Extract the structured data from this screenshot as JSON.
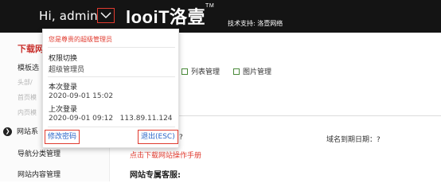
{
  "header": {
    "greeting": "Hi, admin",
    "logo_text": "looiT洛壹",
    "logo_mark": "TM",
    "support": "技术支持: 洛壹网络"
  },
  "sidebar": {
    "heading": "下载网",
    "sub_label": "模板选",
    "faint_items": [
      "头部/",
      "首页模",
      "内页模"
    ],
    "group_label": "网站系",
    "items": [
      "导航分类管理",
      "网站内容管理"
    ]
  },
  "main": {
    "toolbar": [
      "列表管理",
      "图片管理"
    ],
    "question": "?",
    "domain_expiry": "域名到期日期：?",
    "manual_link": "点击下载网站操作手册",
    "service_heading": "网站专属客服:"
  },
  "dropdown": {
    "role": "您是尊贵的超级管理员",
    "switch_label": "权限切换",
    "switch_value": "超级管理员",
    "login_label": "本次登录",
    "login_time": "2020-09-01 15:02",
    "last_login_label": "上次登录",
    "last_login_value": "2020-09-01 09:12   113.89.11.124",
    "change_password": "修改密码",
    "logout": "退出(ESC)"
  },
  "colors": {
    "topbar": "#141414",
    "accent": "#e03b2f",
    "link": "#2a66c8"
  }
}
